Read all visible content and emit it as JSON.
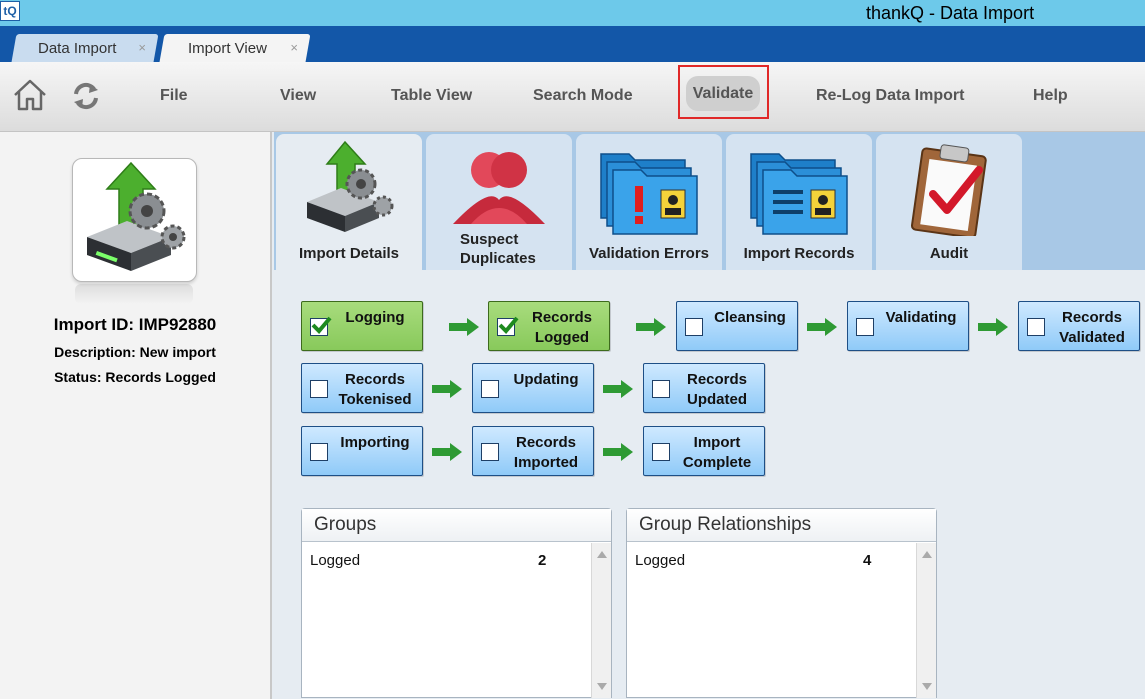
{
  "app": {
    "logo_text": "tQ",
    "title": "thankQ - Data Import"
  },
  "doc_tabs": [
    {
      "label": "Data Import",
      "close": "×",
      "active": false
    },
    {
      "label": "Import View",
      "close": "×",
      "active": true
    }
  ],
  "toolbar": {
    "home_icon": "home-icon",
    "refresh_icon": "refresh-icon",
    "menu": [
      "File",
      "View",
      "Table View",
      "Search Mode",
      "Validate",
      "Re-Log Data Import",
      "Help"
    ]
  },
  "sidebar": {
    "icon": "import-drive-icon",
    "import_id": "Import ID: IMP92880",
    "description": "Description: New import",
    "status": "Status: Records Logged"
  },
  "big_tabs": [
    {
      "label": "Import Details",
      "icon": "import-drive-icon",
      "active": true
    },
    {
      "label": "Suspect\nDuplicates",
      "icon": "duplicate-people-icon",
      "active": false
    },
    {
      "label": "Validation Errors",
      "icon": "validation-errors-folder-icon",
      "active": false
    },
    {
      "label": "Import Records",
      "icon": "import-records-folder-icon",
      "active": false
    },
    {
      "label": "Audit",
      "icon": "clipboard-check-icon",
      "active": false
    }
  ],
  "steps": [
    {
      "label": "Logging",
      "done": true
    },
    {
      "label": "Records\nLogged",
      "done": true
    },
    {
      "label": "Cleansing",
      "done": false
    },
    {
      "label": "Validating",
      "done": false
    },
    {
      "label": "Records\nValidated",
      "done": false
    },
    {
      "label": "Records\nTokenised",
      "done": false
    },
    {
      "label": "Updating",
      "done": false
    },
    {
      "label": "Records\nUpdated",
      "done": false
    },
    {
      "label": "Importing",
      "done": false
    },
    {
      "label": "Records\nImported",
      "done": false
    },
    {
      "label": "Import\nComplete",
      "done": false
    }
  ],
  "groups": {
    "title": "Groups",
    "rows": [
      {
        "label": "Logged",
        "count": "2"
      }
    ]
  },
  "group_relationships": {
    "title": "Group Relationships",
    "rows": [
      {
        "label": "Logged",
        "count": "4"
      }
    ]
  },
  "colors": {
    "titlebar": "#6dc9ea",
    "tabstrip": "#1357a8",
    "step_done": "#88c95b",
    "step_pending": "#8fcaf8",
    "highlight": "#e02828"
  }
}
